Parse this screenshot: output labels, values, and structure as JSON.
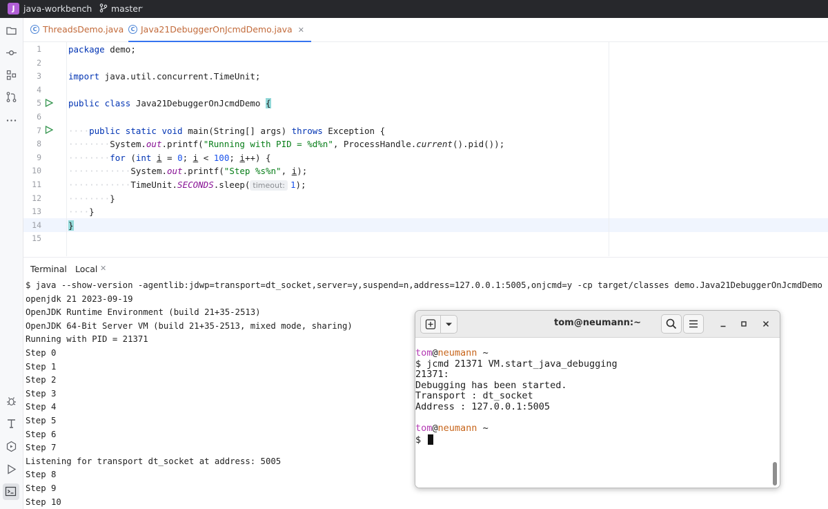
{
  "topbar": {
    "project_initial": "J",
    "project_name": "java-workbench",
    "branch": "master"
  },
  "tabs": [
    {
      "label": "ThreadsDemo.java"
    },
    {
      "label": "Java21DebuggerOnJcmdDemo.java"
    }
  ],
  "editor": {
    "line_numbers": [
      "1",
      "2",
      "3",
      "4",
      "5",
      "6",
      "7",
      "8",
      "9",
      "10",
      "11",
      "12",
      "13",
      "14",
      "15"
    ],
    "lines": {
      "l1_kw": "package",
      "l1_rest": " demo;",
      "l3_kw": "import",
      "l3_rest": " java.util.concurrent.TimeUnit;",
      "l5_kw": "public class",
      "l5_name": " Java21DebuggerOnJcmdDemo ",
      "l5_brace": "{",
      "l7_kw": "public static void",
      "l7_rest": " main(String[] args) ",
      "l7_kw2": "throws",
      "l7_rest2": " Exception {",
      "l8_a": "System.",
      "l8_out": "out",
      "l8_b": ".printf(",
      "l8_str": "\"Running with PID = %d%n\"",
      "l8_c": ", ProcessHandle.",
      "l8_cur": "current",
      "l8_d": "().pid());",
      "l9_kw": "for",
      "l9_a": " (",
      "l9_int": "int",
      "l9_b": " ",
      "l9_i1": "i",
      "l9_c": " = ",
      "l9_n0": "0",
      "l9_d": "; ",
      "l9_i2": "i",
      "l9_e": " < ",
      "l9_n100": "100",
      "l9_f": "; ",
      "l9_i3": "i",
      "l9_g": "++) {",
      "l10_a": "System.",
      "l10_out": "out",
      "l10_b": ".printf(",
      "l10_str": "\"Step %s%n\"",
      "l10_c": ", ",
      "l10_i": "i",
      "l10_d": ");",
      "l11_a": "TimeUnit.",
      "l11_sec": "SECONDS",
      "l11_b": ".sleep(",
      "l11_hint": "timeout:",
      "l11_n": "1",
      "l11_c": ");",
      "l12": "}",
      "l13": "}",
      "l14": "}"
    }
  },
  "terminal": {
    "title": "Terminal",
    "tab": "Local",
    "lines": [
      "$ java --show-version -agentlib:jdwp=transport=dt_socket,server=y,suspend=n,address=127.0.0.1:5005,onjcmd=y -cp target/classes demo.Java21DebuggerOnJcmdDemo",
      "openjdk 21 2023-09-19",
      "OpenJDK Runtime Environment (build 21+35-2513)",
      "OpenJDK 64-Bit Server VM (build 21+35-2513, mixed mode, sharing)",
      "Running with PID = 21371",
      "Step 0",
      "Step 1",
      "Step 2",
      "Step 3",
      "Step 4",
      "Step 5",
      "Step 6",
      "Step 7",
      "Listening for transport dt_socket at address: 5005",
      "Step 8",
      "Step 9",
      "Step 10"
    ]
  },
  "gnome_terminal": {
    "title": "tom@neumann:~",
    "prompt_user": "tom",
    "prompt_at": "@",
    "prompt_host": "neumann",
    "prompt_path": " ~",
    "command": "$ jcmd 21371 VM.start_java_debugging",
    "output": [
      "21371:",
      "Debugging has been started.",
      "Transport : dt_socket",
      "Address : 127.0.0.1:5005"
    ],
    "prompt2_user": "tom",
    "prompt2_at": "@",
    "prompt2_host": "neumann",
    "prompt2_path": " ~",
    "current_prompt": "$ "
  }
}
